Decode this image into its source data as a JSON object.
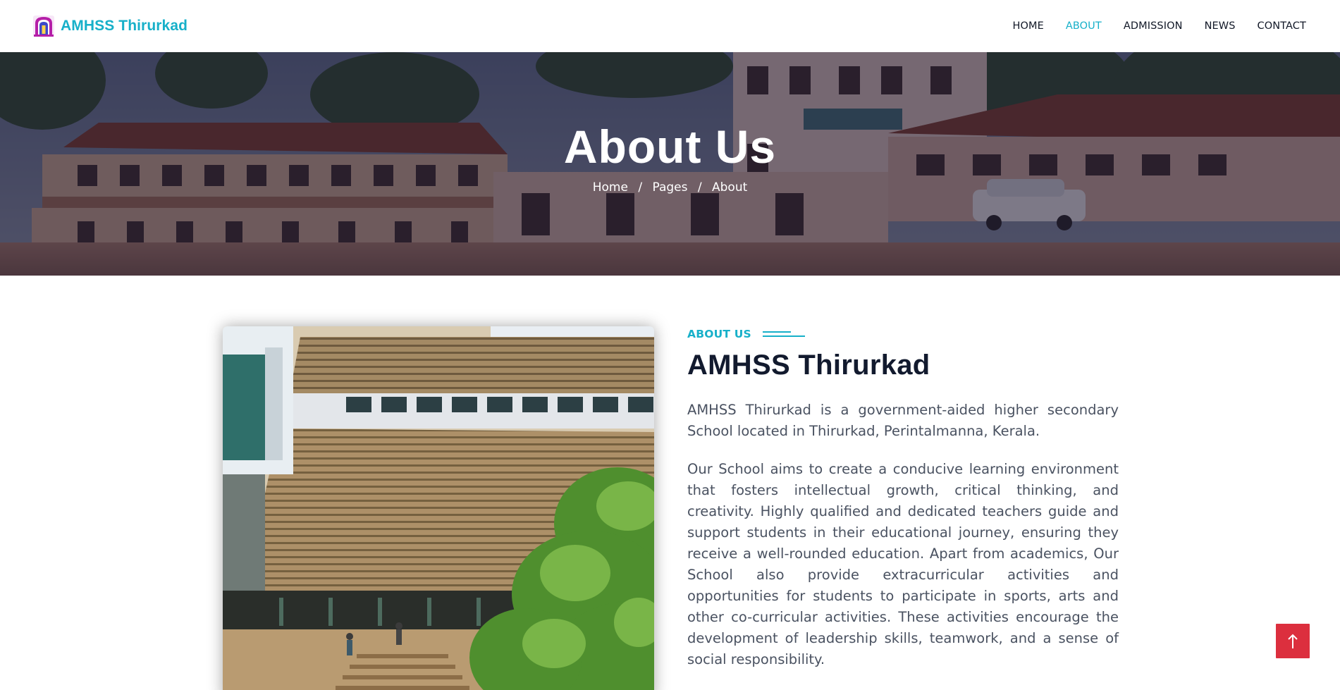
{
  "brand": {
    "name": "AMHSS Thirurkad",
    "logo_icon": "school-logo-icon",
    "color": "#17b0c9"
  },
  "nav": {
    "items": [
      {
        "label": "HOME",
        "active": false
      },
      {
        "label": "ABOUT",
        "active": true
      },
      {
        "label": "ADMISSION",
        "active": false
      },
      {
        "label": "NEWS",
        "active": false
      },
      {
        "label": "CONTACT",
        "active": false
      }
    ],
    "active_color": "#17b0c9"
  },
  "hero": {
    "title": "About Us",
    "breadcrumb": [
      "Home",
      "Pages",
      "About"
    ],
    "separator": "/"
  },
  "about": {
    "eyebrow": "ABOUT US",
    "heading": "AMHSS Thirurkad",
    "paragraphs": [
      "AMHSS Thirurkad is a government-aided higher secondary School located in Thirurkad, Perintalmanna, Kerala.",
      "Our School aims to create a conducive learning environment that fosters intellectual growth, critical thinking, and creativity. Highly qualified and dedicated teachers guide and support students in their educational journey, ensuring they receive a well-rounded education. Apart from academics, Our School also provide extracurricular activities and opportunities for students to participate in sports, arts and other co-curricular activities. These activities encourage the development of leadership skills, teamwork, and a sense of social responsibility."
    ]
  },
  "back_to_top": {
    "icon": "arrow-up-icon",
    "color": "#dc2f3e"
  }
}
